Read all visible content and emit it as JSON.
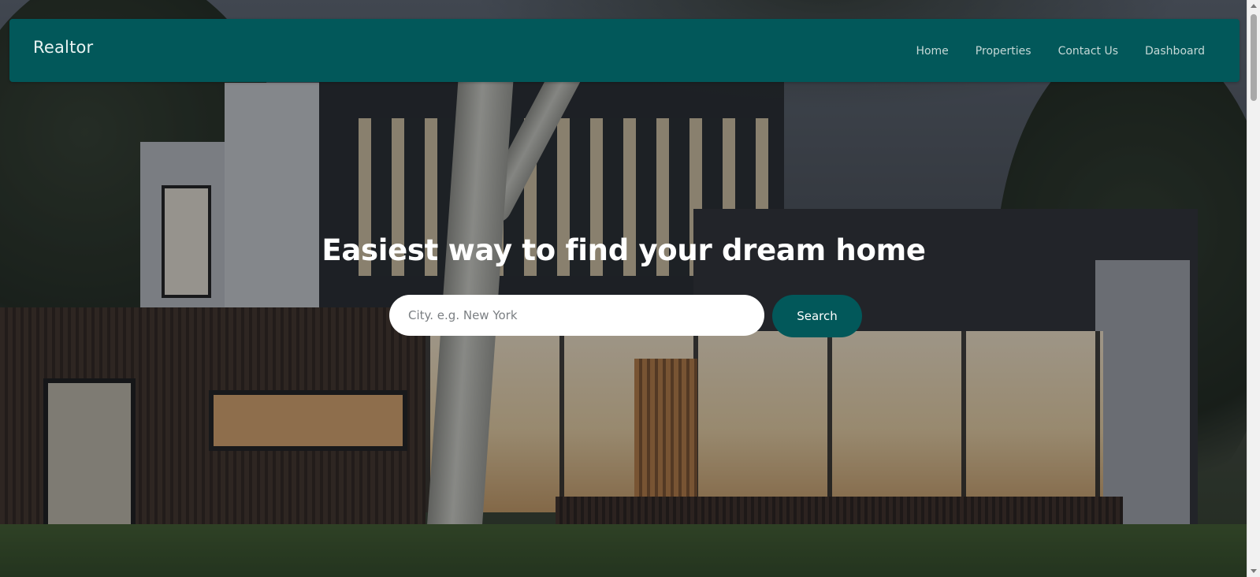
{
  "navbar": {
    "brand": "Realtor",
    "links": [
      "Home",
      "Properties",
      "Contact Us",
      "Dashboard"
    ]
  },
  "hero": {
    "title": "Easiest way to find your dream home",
    "search_placeholder": "City. e.g. New York",
    "search_button": "Search"
  },
  "colors": {
    "primary": "#02585a",
    "nav_text": "#c5d8d6",
    "title_text": "#ffffff"
  }
}
